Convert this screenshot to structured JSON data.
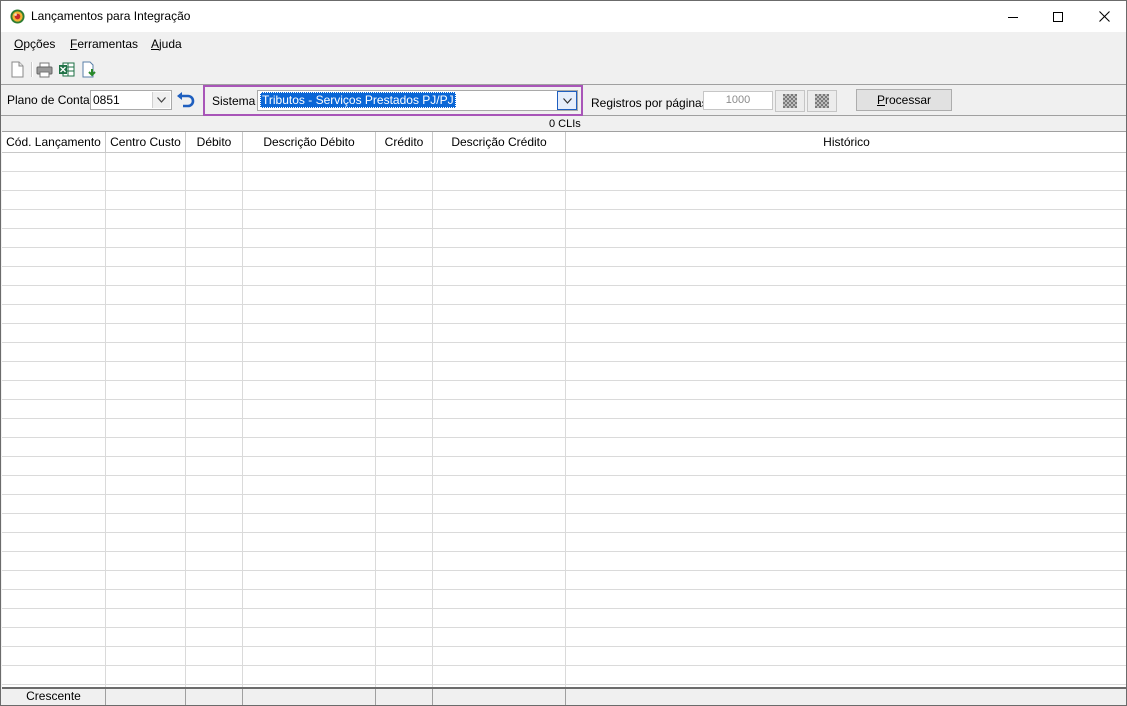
{
  "window": {
    "title": "Lançamentos para Integração",
    "app_icon": "app-logo-icon"
  },
  "menu": {
    "items": [
      {
        "mnemonic": "O",
        "rest": "pções"
      },
      {
        "mnemonic": "F",
        "rest": "erramentas"
      },
      {
        "mnemonic": "A",
        "rest": "juda"
      }
    ]
  },
  "toolbar": {
    "icons": [
      "new-document-icon",
      "print-icon",
      "excel-export-icon",
      "import-icon"
    ]
  },
  "filters": {
    "plano_label": "Plano de Contas",
    "plano_value": "0851",
    "sistema_label": "Sistema",
    "sistema_value": "Tributos - Serviços Prestados PJ/PJ",
    "registros_label": "Registros por páginas:",
    "registros_value": "1000",
    "processar_label": "Processar",
    "processar_mnemonic": "P",
    "processar_rest": "rocessar",
    "highlight_color": "#a855b8"
  },
  "grid": {
    "count_text": "0 CLIs",
    "columns": [
      {
        "key": "cod",
        "label": "Cód. Lançamento"
      },
      {
        "key": "centro",
        "label": "Centro Custo"
      },
      {
        "key": "debito",
        "label": "Débito"
      },
      {
        "key": "desc_debito",
        "label": "Descrição Débito"
      },
      {
        "key": "credito",
        "label": "Crédito"
      },
      {
        "key": "desc_credito",
        "label": "Descrição Crédito"
      },
      {
        "key": "historico",
        "label": "Histórico"
      }
    ],
    "footer": {
      "sort_label": "Crescente"
    }
  }
}
